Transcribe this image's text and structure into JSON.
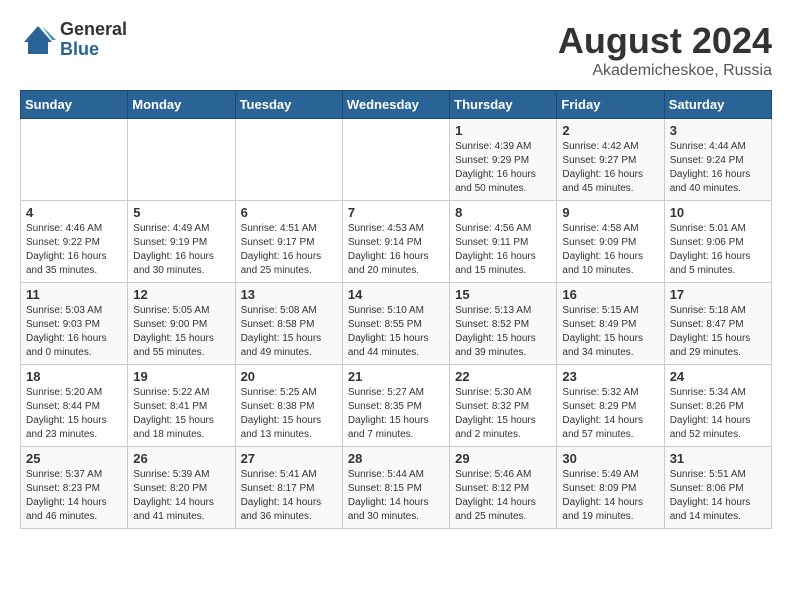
{
  "logo": {
    "general": "General",
    "blue": "Blue"
  },
  "title": {
    "month_year": "August 2024",
    "location": "Akademicheskoe, Russia"
  },
  "days_of_week": [
    "Sunday",
    "Monday",
    "Tuesday",
    "Wednesday",
    "Thursday",
    "Friday",
    "Saturday"
  ],
  "weeks": [
    [
      {
        "day": "",
        "info": ""
      },
      {
        "day": "",
        "info": ""
      },
      {
        "day": "",
        "info": ""
      },
      {
        "day": "",
        "info": ""
      },
      {
        "day": "1",
        "info": "Sunrise: 4:39 AM\nSunset: 9:29 PM\nDaylight: 16 hours\nand 50 minutes."
      },
      {
        "day": "2",
        "info": "Sunrise: 4:42 AM\nSunset: 9:27 PM\nDaylight: 16 hours\nand 45 minutes."
      },
      {
        "day": "3",
        "info": "Sunrise: 4:44 AM\nSunset: 9:24 PM\nDaylight: 16 hours\nand 40 minutes."
      }
    ],
    [
      {
        "day": "4",
        "info": "Sunrise: 4:46 AM\nSunset: 9:22 PM\nDaylight: 16 hours\nand 35 minutes."
      },
      {
        "day": "5",
        "info": "Sunrise: 4:49 AM\nSunset: 9:19 PM\nDaylight: 16 hours\nand 30 minutes."
      },
      {
        "day": "6",
        "info": "Sunrise: 4:51 AM\nSunset: 9:17 PM\nDaylight: 16 hours\nand 25 minutes."
      },
      {
        "day": "7",
        "info": "Sunrise: 4:53 AM\nSunset: 9:14 PM\nDaylight: 16 hours\nand 20 minutes."
      },
      {
        "day": "8",
        "info": "Sunrise: 4:56 AM\nSunset: 9:11 PM\nDaylight: 16 hours\nand 15 minutes."
      },
      {
        "day": "9",
        "info": "Sunrise: 4:58 AM\nSunset: 9:09 PM\nDaylight: 16 hours\nand 10 minutes."
      },
      {
        "day": "10",
        "info": "Sunrise: 5:01 AM\nSunset: 9:06 PM\nDaylight: 16 hours\nand 5 minutes."
      }
    ],
    [
      {
        "day": "11",
        "info": "Sunrise: 5:03 AM\nSunset: 9:03 PM\nDaylight: 16 hours\nand 0 minutes."
      },
      {
        "day": "12",
        "info": "Sunrise: 5:05 AM\nSunset: 9:00 PM\nDaylight: 15 hours\nand 55 minutes."
      },
      {
        "day": "13",
        "info": "Sunrise: 5:08 AM\nSunset: 8:58 PM\nDaylight: 15 hours\nand 49 minutes."
      },
      {
        "day": "14",
        "info": "Sunrise: 5:10 AM\nSunset: 8:55 PM\nDaylight: 15 hours\nand 44 minutes."
      },
      {
        "day": "15",
        "info": "Sunrise: 5:13 AM\nSunset: 8:52 PM\nDaylight: 15 hours\nand 39 minutes."
      },
      {
        "day": "16",
        "info": "Sunrise: 5:15 AM\nSunset: 8:49 PM\nDaylight: 15 hours\nand 34 minutes."
      },
      {
        "day": "17",
        "info": "Sunrise: 5:18 AM\nSunset: 8:47 PM\nDaylight: 15 hours\nand 29 minutes."
      }
    ],
    [
      {
        "day": "18",
        "info": "Sunrise: 5:20 AM\nSunset: 8:44 PM\nDaylight: 15 hours\nand 23 minutes."
      },
      {
        "day": "19",
        "info": "Sunrise: 5:22 AM\nSunset: 8:41 PM\nDaylight: 15 hours\nand 18 minutes."
      },
      {
        "day": "20",
        "info": "Sunrise: 5:25 AM\nSunset: 8:38 PM\nDaylight: 15 hours\nand 13 minutes."
      },
      {
        "day": "21",
        "info": "Sunrise: 5:27 AM\nSunset: 8:35 PM\nDaylight: 15 hours\nand 7 minutes."
      },
      {
        "day": "22",
        "info": "Sunrise: 5:30 AM\nSunset: 8:32 PM\nDaylight: 15 hours\nand 2 minutes."
      },
      {
        "day": "23",
        "info": "Sunrise: 5:32 AM\nSunset: 8:29 PM\nDaylight: 14 hours\nand 57 minutes."
      },
      {
        "day": "24",
        "info": "Sunrise: 5:34 AM\nSunset: 8:26 PM\nDaylight: 14 hours\nand 52 minutes."
      }
    ],
    [
      {
        "day": "25",
        "info": "Sunrise: 5:37 AM\nSunset: 8:23 PM\nDaylight: 14 hours\nand 46 minutes."
      },
      {
        "day": "26",
        "info": "Sunrise: 5:39 AM\nSunset: 8:20 PM\nDaylight: 14 hours\nand 41 minutes."
      },
      {
        "day": "27",
        "info": "Sunrise: 5:41 AM\nSunset: 8:17 PM\nDaylight: 14 hours\nand 36 minutes."
      },
      {
        "day": "28",
        "info": "Sunrise: 5:44 AM\nSunset: 8:15 PM\nDaylight: 14 hours\nand 30 minutes."
      },
      {
        "day": "29",
        "info": "Sunrise: 5:46 AM\nSunset: 8:12 PM\nDaylight: 14 hours\nand 25 minutes."
      },
      {
        "day": "30",
        "info": "Sunrise: 5:49 AM\nSunset: 8:09 PM\nDaylight: 14 hours\nand 19 minutes."
      },
      {
        "day": "31",
        "info": "Sunrise: 5:51 AM\nSunset: 8:06 PM\nDaylight: 14 hours\nand 14 minutes."
      }
    ]
  ]
}
